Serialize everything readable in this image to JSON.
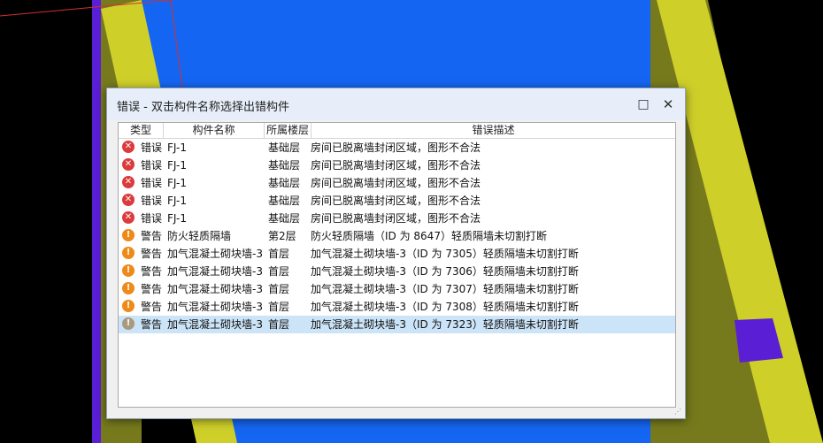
{
  "dialog": {
    "title": "错误 - 双击构件名称选择出错构件",
    "maximize_icon": "□",
    "close_icon": "✕"
  },
  "columns": [
    "类型",
    "构件名称",
    "所属楼层",
    "错误描述"
  ],
  "colors": {
    "error": "#dd3b3b",
    "warning": "#ee8a19",
    "warning_selected": "#a8997f",
    "selected_row": "#cce4f7",
    "scene_blue": "#1466f2",
    "scene_yellow": "#cfcf2a",
    "scene_olive": "#777a1c",
    "scene_purple": "#5a1ed4"
  },
  "rows": [
    {
      "icon": "error-icon",
      "glyph": "✕",
      "type": "错误",
      "name": "FJ-1",
      "floor": "基础层",
      "desc": "房间已脱离墙封闭区域，图形不合法"
    },
    {
      "icon": "error-icon",
      "glyph": "✕",
      "type": "错误",
      "name": "FJ-1",
      "floor": "基础层",
      "desc": "房间已脱离墙封闭区域，图形不合法"
    },
    {
      "icon": "error-icon",
      "glyph": "✕",
      "type": "错误",
      "name": "FJ-1",
      "floor": "基础层",
      "desc": "房间已脱离墙封闭区域，图形不合法"
    },
    {
      "icon": "error-icon",
      "glyph": "✕",
      "type": "错误",
      "name": "FJ-1",
      "floor": "基础层",
      "desc": "房间已脱离墙封闭区域，图形不合法"
    },
    {
      "icon": "error-icon",
      "glyph": "✕",
      "type": "错误",
      "name": "FJ-1",
      "floor": "基础层",
      "desc": "房间已脱离墙封闭区域，图形不合法"
    },
    {
      "icon": "warning-icon",
      "glyph": "!",
      "type": "警告",
      "name": "防火轻质隔墙",
      "floor": "第2层",
      "desc": "防火轻质隔墙（ID 为 8647）轻质隔墙未切割打断"
    },
    {
      "icon": "warning-icon",
      "glyph": "!",
      "type": "警告",
      "name": "加气混凝土砌块墙-3",
      "floor": "首层",
      "desc": "加气混凝土砌块墙-3（ID 为 7305）轻质隔墙未切割打断"
    },
    {
      "icon": "warning-icon",
      "glyph": "!",
      "type": "警告",
      "name": "加气混凝土砌块墙-3",
      "floor": "首层",
      "desc": "加气混凝土砌块墙-3（ID 为 7306）轻质隔墙未切割打断"
    },
    {
      "icon": "warning-icon",
      "glyph": "!",
      "type": "警告",
      "name": "加气混凝土砌块墙-3",
      "floor": "首层",
      "desc": "加气混凝土砌块墙-3（ID 为 7307）轻质隔墙未切割打断"
    },
    {
      "icon": "warning-icon",
      "glyph": "!",
      "type": "警告",
      "name": "加气混凝土砌块墙-3",
      "floor": "首层",
      "desc": "加气混凝土砌块墙-3（ID 为 7308）轻质隔墙未切割打断"
    },
    {
      "icon": "warning-icon",
      "glyph": "!",
      "type": "警告",
      "name": "加气混凝土砌块墙-3",
      "floor": "首层",
      "desc": "加气混凝土砌块墙-3（ID 为 7323）轻质隔墙未切割打断",
      "selected": true
    }
  ]
}
